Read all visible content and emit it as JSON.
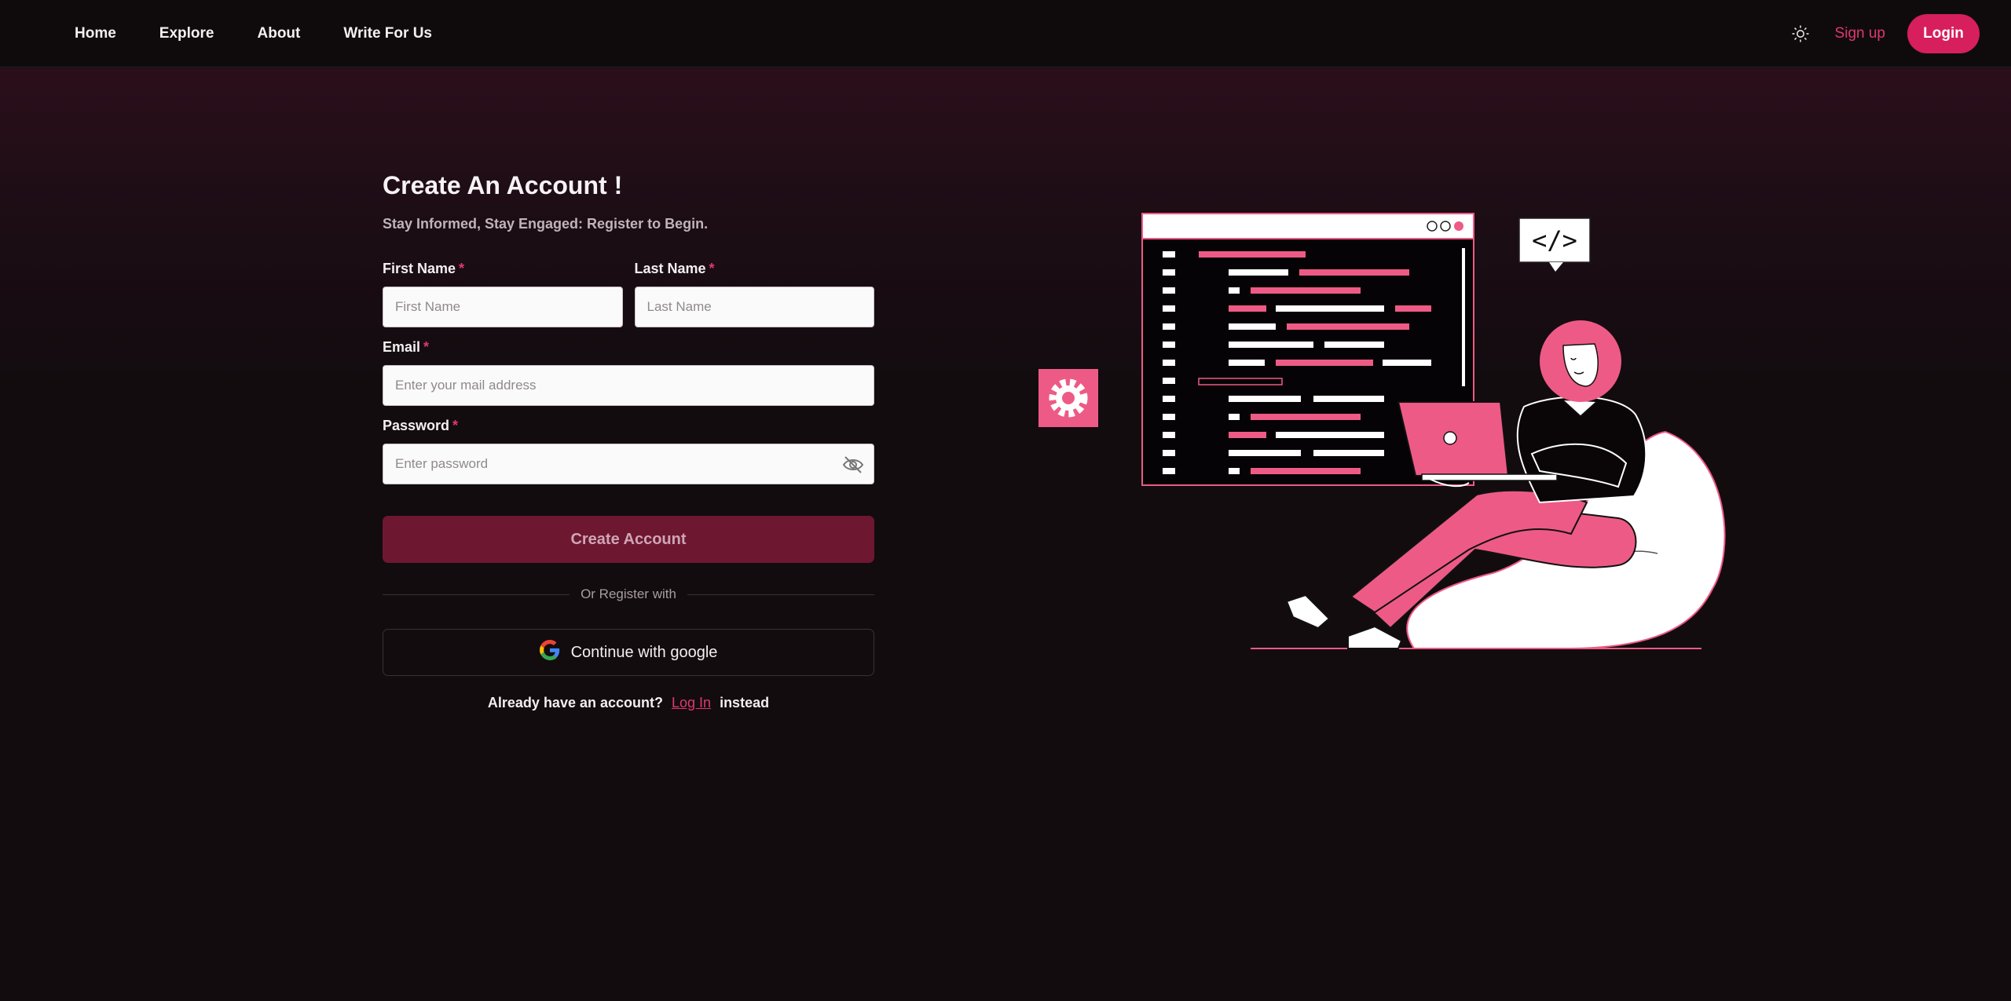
{
  "nav": {
    "links": [
      "Home",
      "Explore",
      "About",
      "Write For Us"
    ],
    "signup_label": "Sign up",
    "login_label": "Login",
    "theme_icon": "sun-icon"
  },
  "form": {
    "title": "Create An Account !",
    "subtitle": "Stay Informed, Stay Engaged: Register to Begin.",
    "first_name": {
      "label": "First Name",
      "required": "*",
      "placeholder": "First Name"
    },
    "last_name": {
      "label": "Last Name",
      "required": "*",
      "placeholder": "Last Name"
    },
    "email": {
      "label": "Email",
      "required": "*",
      "placeholder": "Enter your mail address"
    },
    "password": {
      "label": "Password",
      "required": "*",
      "placeholder": "Enter password"
    },
    "submit_label": "Create Account",
    "divider_text": "Or Register with",
    "google_label": "Continue with google",
    "footer": {
      "prefix": "Already have an account?",
      "link": "Log In",
      "suffix": "instead"
    }
  },
  "colors": {
    "accent": "#e0386f",
    "button_dark": "#6e1731",
    "background": "#120c0f",
    "illustration_pink": "#ee5a86"
  },
  "illustration": {
    "code_tag": "</>"
  }
}
